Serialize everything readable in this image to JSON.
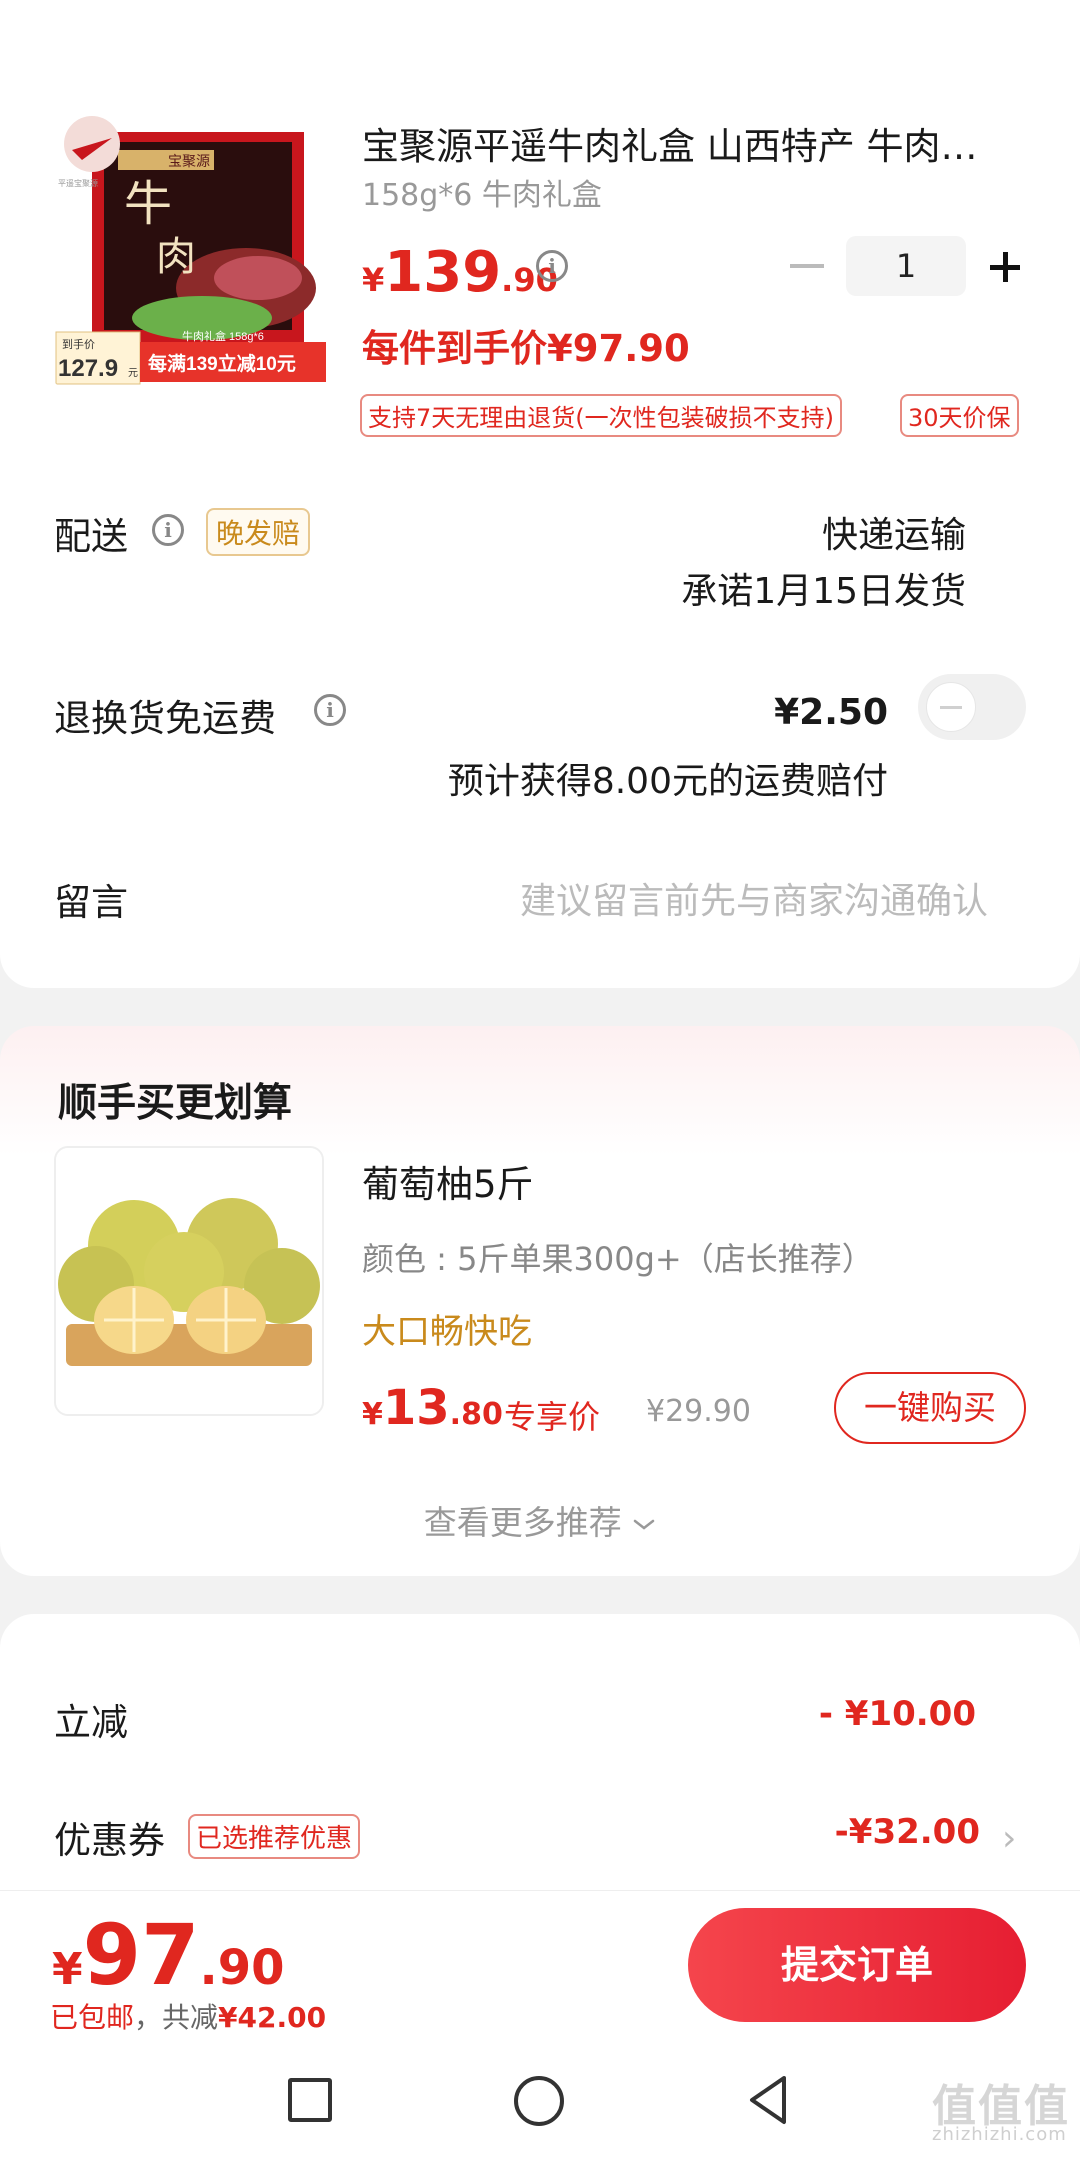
{
  "product": {
    "title": "宝聚源平遥牛肉礼盒 山西特产 牛肉…",
    "spec": "158g*6 牛肉礼盒",
    "price_currency": "¥",
    "price_int": "139",
    "price_dec": ".90",
    "quantity": "1",
    "unit_price": "每件到手价¥97.90",
    "tags": [
      "支持7天无理由退货(一次性包装破损不支持)",
      "30天价保"
    ],
    "image": {
      "brand_text": "宝聚源",
      "logo_small": "平遥宝聚源",
      "big_char1": "牛",
      "big_char2": "肉",
      "box_label": "牛肉礼盒 158g*6",
      "badge_label": "到手价",
      "badge_price": "127.9",
      "badge_unit": "元",
      "promo": "每满139立减10元"
    }
  },
  "delivery": {
    "label": "配送",
    "late_tag": "晚发赔",
    "method": "快递运输",
    "promise": "承诺1月15日发货"
  },
  "return_shipping": {
    "label": "退换货免运费",
    "price": "¥2.50",
    "note": "预计获得8.00元的运费赔付"
  },
  "message": {
    "label": "留言",
    "placeholder": "建议留言前先与商家沟通确认"
  },
  "recommend": {
    "heading": "顺手买更划算",
    "item": {
      "name": "葡萄柚5斤",
      "color": "颜色 : 5斤单果300g+（店长推荐）",
      "slogan": "大口畅快吃",
      "price_currency": "¥",
      "price_int": "13",
      "price_dec": ".80",
      "exclusive_label": "专享价",
      "original_price": "¥29.90",
      "buy_label": "一键购买"
    },
    "more": "查看更多推荐"
  },
  "discounts": {
    "instant_label": "立减",
    "instant_value": "- ¥10.00",
    "coupon_label": "优惠券",
    "coupon_tag": "已选推荐优惠",
    "coupon_value": "-¥32.00"
  },
  "footer": {
    "total_currency": "¥",
    "total_int": "97",
    "total_dec": ".90",
    "shipping": "已包邮",
    "separator": "，",
    "saved_prefix": "共减",
    "saved_amount": "¥42.00",
    "submit_label": "提交订单"
  },
  "watermark": {
    "main": "值值值",
    "sub": "zhizhizhi.com"
  },
  "colors": {
    "accent_red": "#e0271f",
    "gold": "#c98a1c",
    "button_gradient_start": "#f5454c",
    "button_gradient_end": "#e61e32"
  }
}
